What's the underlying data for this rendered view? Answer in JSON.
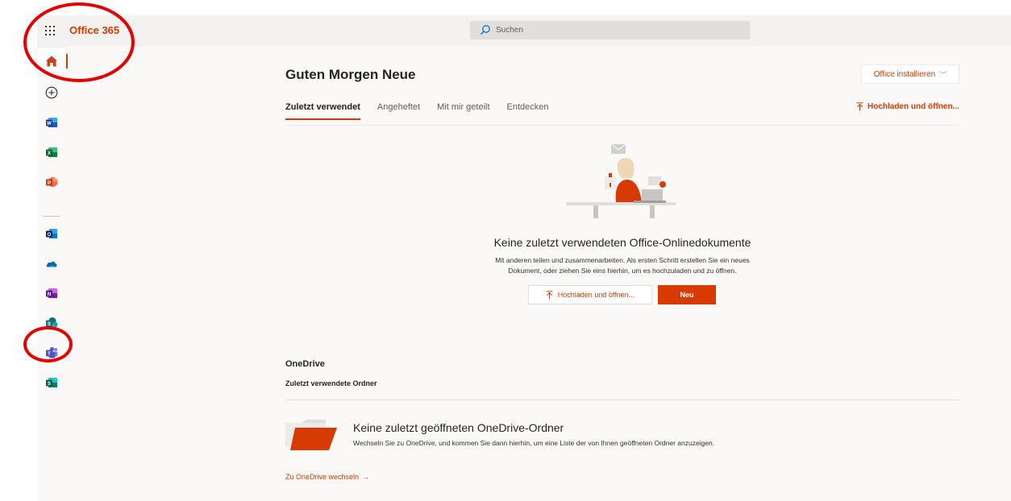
{
  "topbar": {
    "brand": "Office 365",
    "search_placeholder": "Suchen"
  },
  "rail": {
    "items": [
      {
        "name": "Startseite",
        "icon": "home-icon"
      },
      {
        "name": "Erstellen",
        "icon": "plus-circle-icon"
      },
      {
        "name": "Word",
        "icon": "word-icon"
      },
      {
        "name": "Excel",
        "icon": "excel-icon"
      },
      {
        "name": "PowerPoint",
        "icon": "powerpoint-icon"
      },
      {
        "name": "Outlook",
        "icon": "outlook-icon"
      },
      {
        "name": "OneDrive",
        "icon": "onedrive-icon"
      },
      {
        "name": "OneNote",
        "icon": "onenote-icon"
      },
      {
        "name": "SharePoint",
        "icon": "sharepoint-icon"
      },
      {
        "name": "Teams",
        "icon": "teams-icon"
      },
      {
        "name": "Sway",
        "icon": "sway-icon"
      }
    ]
  },
  "main": {
    "greeting": "Guten Morgen Neue",
    "install_label": "Office installieren",
    "tabs": [
      {
        "label": "Zuletzt verwendet",
        "active": true
      },
      {
        "label": "Angeheftet",
        "active": false
      },
      {
        "label": "Mit mir geteilt",
        "active": false
      },
      {
        "label": "Entdecken",
        "active": false
      }
    ],
    "upload_label": "Hochladen und öffnen...",
    "empty_title": "Keine zuletzt verwendeten Office-Onlinedokumente",
    "empty_desc_line1": "Mit anderen teilen und zusammenarbeiten. Als ersten Schritt erstellen Sie ein neues",
    "empty_desc_line2": "Dokument, oder ziehen Sie eins hierhin, um es hochzuladen und zu öffnen.",
    "upload_button": "Hochladen und öffnen...",
    "new_button": "Neu"
  },
  "onedrive": {
    "title": "OneDrive",
    "subtitle": "Zuletzt verwendete Ordner",
    "empty_title": "Keine zuletzt geöffneten OneDrive-Ordner",
    "empty_desc": "Wechseln Sie zu OneDrive, und kommen Sie dann hierhin, um eine Liste der von Ihnen geöffneten Ordner anzuzeigen.",
    "link": "Zu OneDrive wechseln"
  },
  "colors": {
    "accent": "#d83b01",
    "annotation": "#e60000"
  }
}
